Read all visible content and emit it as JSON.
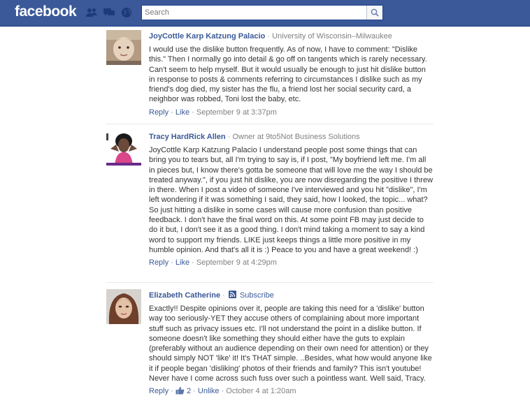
{
  "header": {
    "logo": "facebook",
    "search": {
      "placeholder": "Search",
      "value": ""
    }
  },
  "comments": [
    {
      "name": "JoyCottle Karp Katzung Palacio",
      "separator": "·",
      "affiliation": "University of Wisconsin–Milwaukee",
      "text": "I would use the dislike button frequently. As of now, I have to comment: \"Dislike this.\" Then I normally go into detail & go off on tangents which is rarely necessary. Can't seem to help myself. But it would usually be enough to just hit dislike button in response to posts & comments referring to circumstances I dislike such as my friend's dog died, my sister has the flu, a friend lost her social security card, a neighbor was robbed, Toni lost the baby, etc.",
      "reply": "Reply",
      "like": "Like",
      "timestamp": "September 9 at 3:37pm"
    },
    {
      "name": "Tracy HardRick Allen",
      "separator": "·",
      "affiliation": "Owner at 9to5Not Business Solutions",
      "text": "JoyCottle Karp Katzung Palacio I understand people post some things that can bring you to tears but, all I'm trying to say is, if I post, \"My boyfriend left me. I'm all in pieces but, I know there's gotta be someone that will love me the way I should be treated anyway.\", if you just hit dislike, you are now disregarding the positive I threw in there. When I post a video of someone I've interviewed and you hit \"dislike\", I'm left wondering if it was something I said, they said, how I looked, the topic... what? So just hitting a dislike in some cases will cause more confusion than positive feedback. I don't have the final word on this. At some point FB may just decide to do it but, I don't see it as a good thing. I don't mind taking a moment to say a kind word to support my friends. LIKE just keeps things a little more positive in my humble opinion. And that's all it is :) Peace to you and have a great weekend! :)",
      "reply": "Reply",
      "like": "Like",
      "timestamp": "September 9 at 4:29pm"
    },
    {
      "name": "Elizabeth Catherine",
      "separator": "·",
      "subscribe": "Subscribe",
      "text": "Exactly!! Despite opinions over it, people are taking this need for a 'dislike' button way too seriously-YET they accuse others of complaining about more important stuff such as privacy issues etc. I'll not understand the point in a dislike button. If someone doesn't like something they should either have the guts to explain (preferably without an audience depending on their own need for attention) or they should simply NOT 'like' it! It's THAT simple. ..Besides, what how would anyone like it if people began 'disliking' photos of their friends and family? This isn't youtube! Never have I come across such fuss over such a pointless want. Well said, Tracy.",
      "reply": "Reply",
      "like_count": "2",
      "unlike": "Unlike",
      "timestamp": "October 4 at 1:20am"
    }
  ],
  "colors": {
    "topbar": "#3b5998",
    "link": "#3b5998",
    "meta": "#808080",
    "text": "#333333"
  },
  "icons": [
    "friend-requests-icon",
    "messages-icon",
    "notifications-globe-icon",
    "search-magnifier-icon",
    "rss-subscribe-icon",
    "thumbs-up-icon"
  ]
}
